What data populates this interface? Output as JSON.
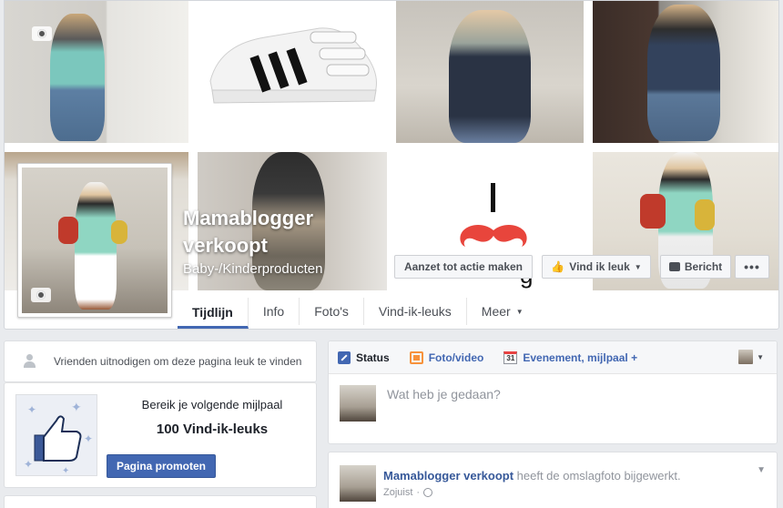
{
  "page": {
    "name_line1": "Mamablogger",
    "name_line2": "verkoopt",
    "category": "Baby-/Kinderproducten"
  },
  "cover_text": {
    "partial_glyph": "g"
  },
  "actions": {
    "cta": "Aanzet tot actie maken",
    "like": "Vind ik leuk",
    "message": "Bericht",
    "more": "•••"
  },
  "tabs": [
    {
      "label": "Tijdlijn",
      "active": true
    },
    {
      "label": "Info"
    },
    {
      "label": "Foto's"
    },
    {
      "label": "Vind-ik-leuks"
    },
    {
      "label": "Meer"
    }
  ],
  "invite": {
    "text": "Vrienden uitnodigen om deze pagina leuk te vinden"
  },
  "milestone": {
    "line1": "Bereik je volgende mijlpaal",
    "line2": "100 Vind-ik-leuks",
    "button": "Pagina promoten"
  },
  "composer": {
    "tabs": [
      {
        "label": "Status",
        "icon": "status-icon"
      },
      {
        "label": "Foto/video",
        "icon": "photo-icon"
      },
      {
        "label": "Evenement, mijlpaal +",
        "icon": "calendar-icon",
        "icon_text": "31"
      }
    ],
    "placeholder": "Wat heb je gedaan?"
  },
  "post": {
    "author": "Mamablogger verkoopt",
    "action": " heeft de omslagfoto bijgewerkt.",
    "time": "Zojuist",
    "privacy_separator": "·"
  },
  "colors": {
    "brand_blue": "#4267b2",
    "link_blue": "#365899",
    "background": "#e9ebee",
    "mustache_red": "#e8453c"
  }
}
